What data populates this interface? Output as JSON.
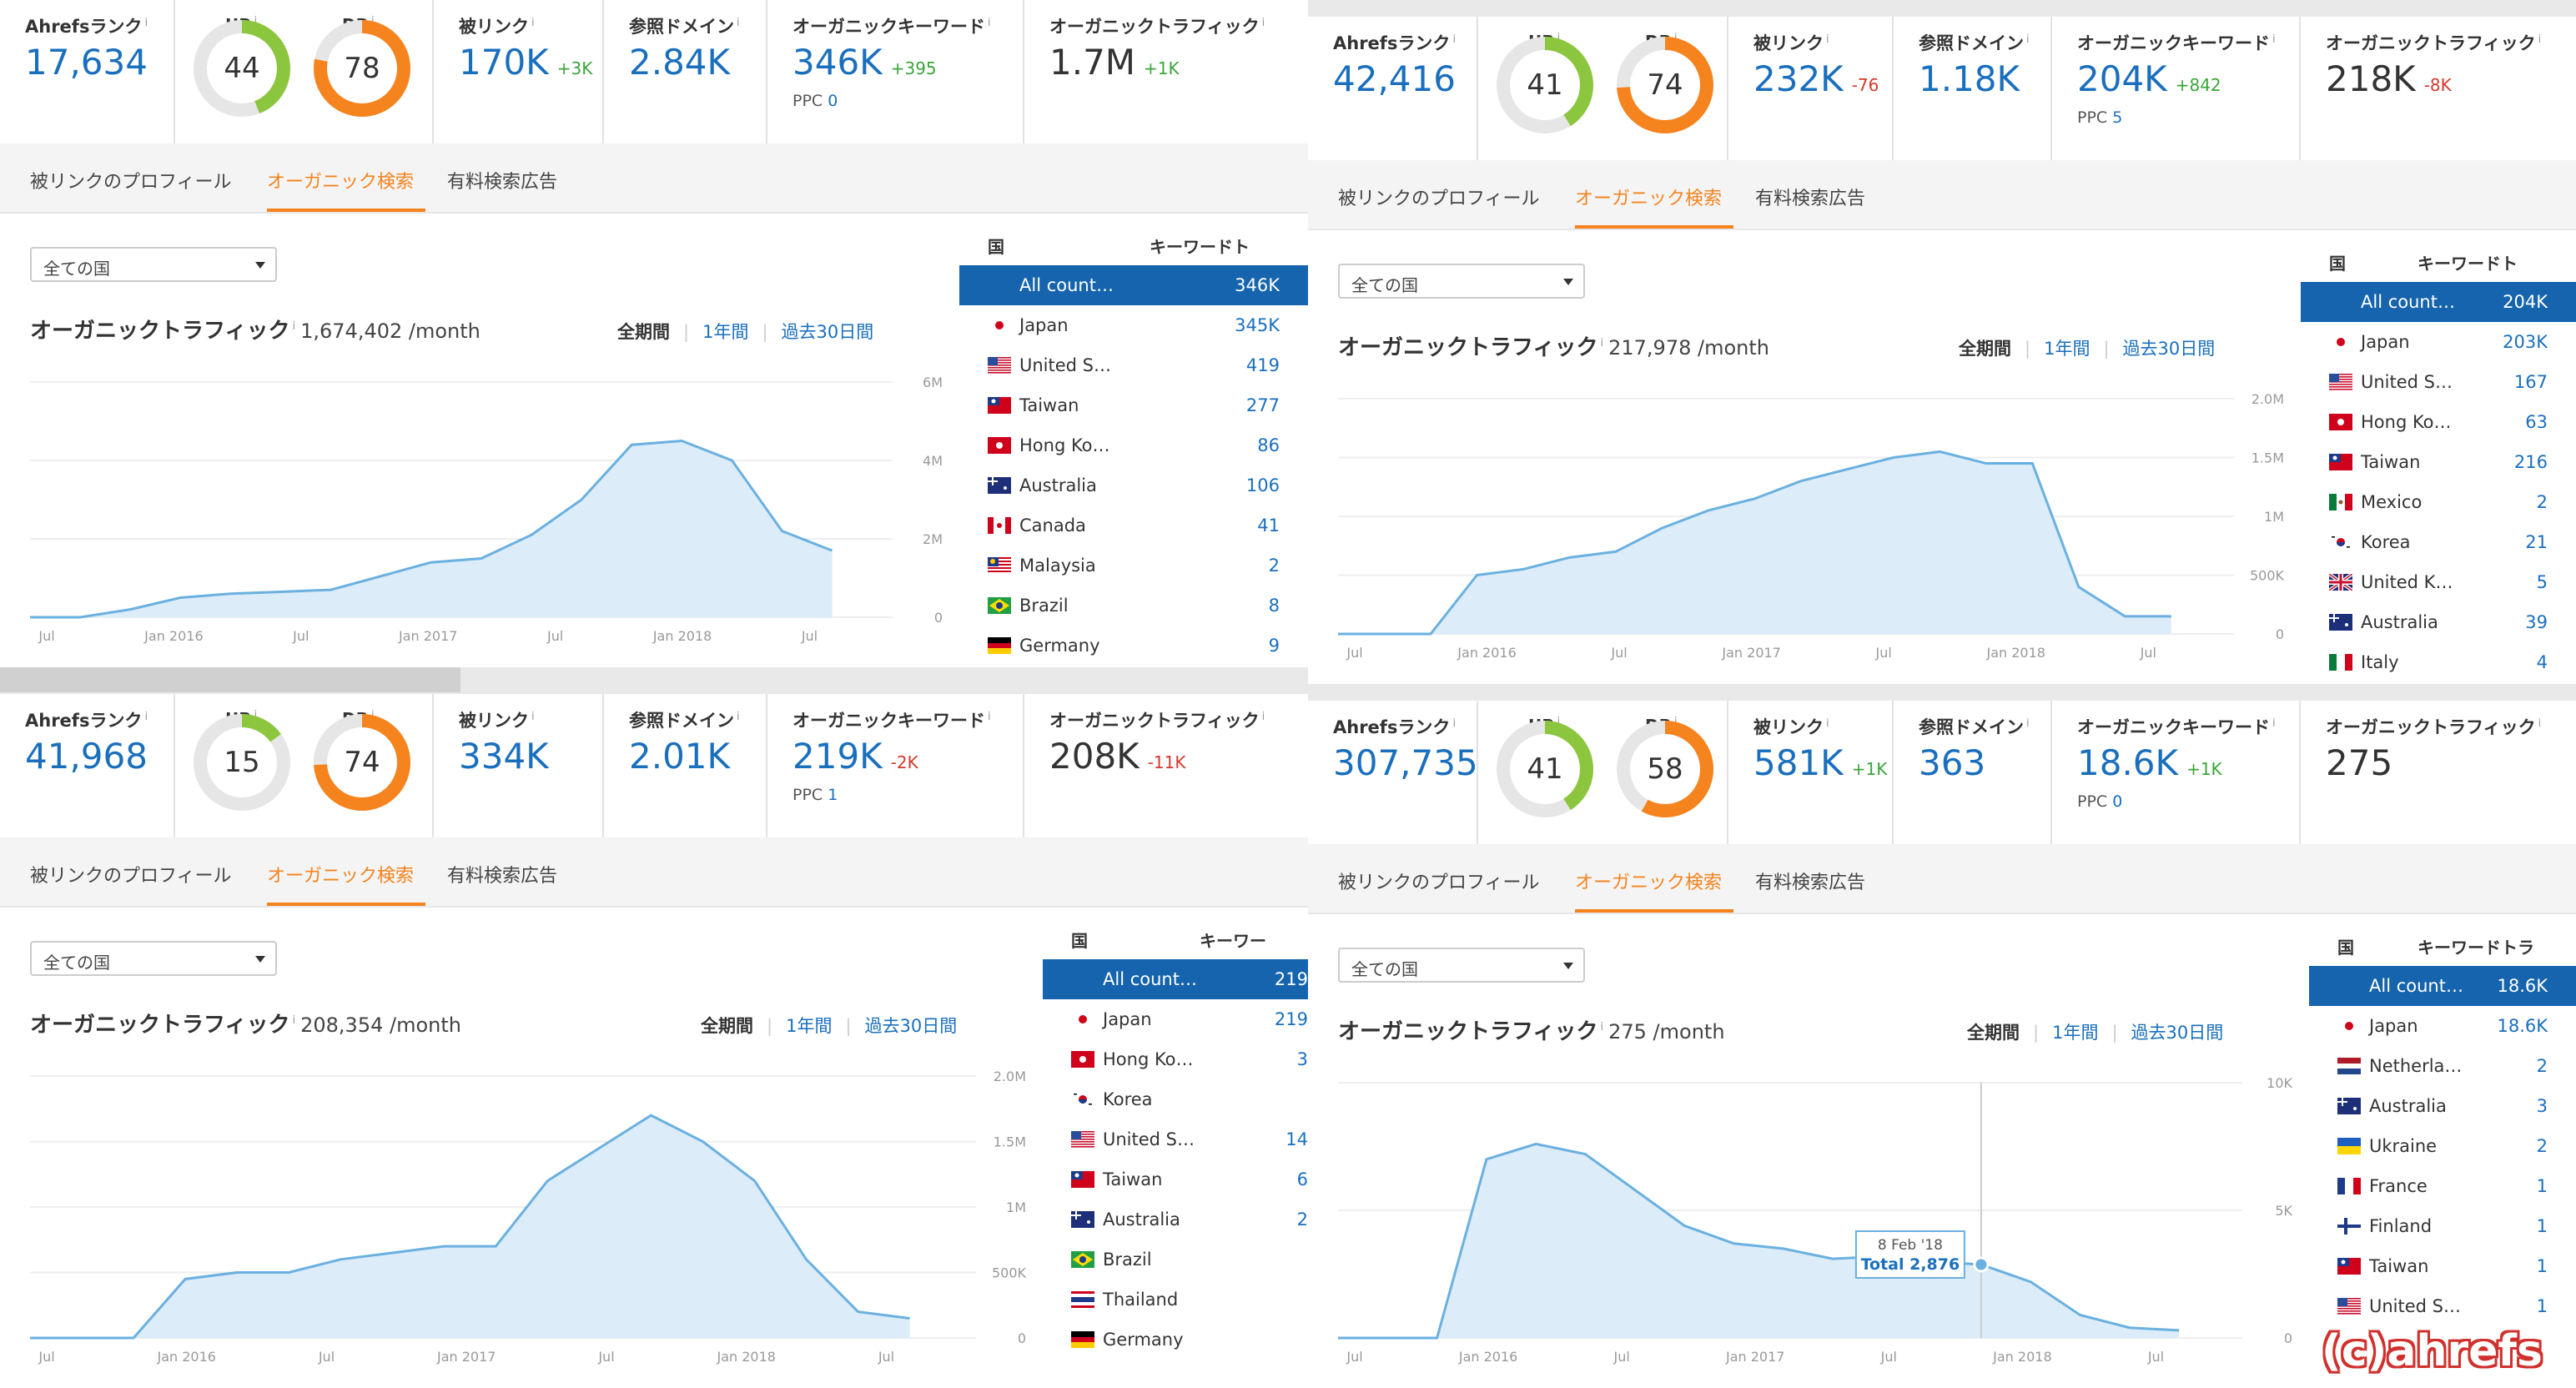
{
  "labels": {
    "rank": "Ahrefsランク",
    "ur": "UR",
    "dr": "DR",
    "backlinks": "被リンク",
    "refdomains": "参照ドメイン",
    "keywords": "オーガニックキーワード",
    "traffic": "オーガニックトラフィック",
    "ppc": "PPC",
    "info": "i",
    "tab_backlinks": "被リンクのプロフィール",
    "tab_organic": "オーガニック検索",
    "tab_paid": "有料検索広告",
    "country_select": "全ての国",
    "chart_title": "オーガニックトラフィック",
    "range_all": "全期間",
    "range_1y": "1年間",
    "range_30d": "過去30日間",
    "col_country": "国",
    "col_keywords": "キーワードト",
    "col_keywords_short": "キーワー",
    "col_keywords_4": "キーワードトラ"
  },
  "colors": {
    "accent": "#f5841f",
    "link": "#1a6fbd",
    "selected_row": "#1564ad",
    "ur_ring": "#8cc63f",
    "dr_ring": "#f5841f",
    "chart_line": "#6ab0e0",
    "chart_fill": "#dcecf8"
  },
  "panels": [
    {
      "rank": "17,634",
      "ur": "44",
      "ur_pct": 44,
      "dr": "78",
      "dr_pct": 78,
      "backlinks": "170K",
      "backlinks_delta": "+3K",
      "refdomains": "2.84K",
      "keywords": "346K",
      "keywords_delta": "+395",
      "ppc": "0",
      "traffic": "1.7M",
      "traffic_delta": "+1K",
      "monthly": "1,674,402 /month",
      "countries": [
        {
          "name": "All count…",
          "value": "346K",
          "flag": "none"
        },
        {
          "name": "Japan",
          "value": "345K",
          "flag": "jp"
        },
        {
          "name": "United S…",
          "value": "419",
          "flag": "us"
        },
        {
          "name": "Taiwan",
          "value": "277",
          "flag": "tw"
        },
        {
          "name": "Hong Ko…",
          "value": "86",
          "flag": "hk"
        },
        {
          "name": "Australia",
          "value": "106",
          "flag": "au"
        },
        {
          "name": "Canada",
          "value": "41",
          "flag": "ca"
        },
        {
          "name": "Malaysia",
          "value": "2",
          "flag": "my"
        },
        {
          "name": "Brazil",
          "value": "8",
          "flag": "br"
        },
        {
          "name": "Germany",
          "value": "9",
          "flag": "de"
        }
      ],
      "chart_data": {
        "type": "area",
        "x": [
          "2015-07",
          "2015-10",
          "2016-01",
          "2016-04",
          "2016-07",
          "2016-10",
          "2017-01",
          "2017-04",
          "2017-07",
          "2017-10",
          "2018-01",
          "2018-03",
          "2018-05",
          "2018-06",
          "2018-07",
          "2018-08",
          "2018-09"
        ],
        "y": [
          0,
          0,
          200000,
          500000,
          600000,
          650000,
          700000,
          1050000,
          1400000,
          1500000,
          2100000,
          3000000,
          4400000,
          4500000,
          4000000,
          2200000,
          1700000
        ],
        "yticks": [
          "6M",
          "4M",
          "2M",
          "0"
        ],
        "ylim": [
          0,
          6000000
        ],
        "xticks": [
          "Jul",
          "Jan 2016",
          "Jul",
          "Jan 2017",
          "Jul",
          "Jan 2018",
          "Jul"
        ]
      }
    },
    {
      "rank": "42,416",
      "ur": "41",
      "ur_pct": 41,
      "dr": "74",
      "dr_pct": 74,
      "backlinks": "232K",
      "backlinks_delta": "-76",
      "refdomains": "1.18K",
      "keywords": "204K",
      "keywords_delta": "+842",
      "ppc": "5",
      "traffic": "218K",
      "traffic_delta": "-8K",
      "monthly": "217,978 /month",
      "countries": [
        {
          "name": "All count…",
          "value": "204K",
          "flag": "none"
        },
        {
          "name": "Japan",
          "value": "203K",
          "flag": "jp"
        },
        {
          "name": "United S…",
          "value": "167",
          "flag": "us"
        },
        {
          "name": "Hong Ko…",
          "value": "63",
          "flag": "hk"
        },
        {
          "name": "Taiwan",
          "value": "216",
          "flag": "tw"
        },
        {
          "name": "Mexico",
          "value": "2",
          "flag": "mx"
        },
        {
          "name": "Korea",
          "value": "21",
          "flag": "kr"
        },
        {
          "name": "United K…",
          "value": "5",
          "flag": "gb"
        },
        {
          "name": "Australia",
          "value": "39",
          "flag": "au"
        },
        {
          "name": "Italy",
          "value": "4",
          "flag": "it"
        }
      ],
      "chart_data": {
        "type": "area",
        "x": [
          "2015-07",
          "2015-10",
          "2016-01",
          "2016-01b",
          "2016-04",
          "2016-07",
          "2016-10",
          "2017-01",
          "2017-04",
          "2017-07",
          "2017-10",
          "2018-01",
          "2018-03",
          "2018-04",
          "2018-05",
          "2018-06",
          "2018-07",
          "2018-08",
          "2018-09"
        ],
        "y": [
          0,
          0,
          0,
          500000,
          550000,
          650000,
          700000,
          900000,
          1050000,
          1150000,
          1300000,
          1400000,
          1500000,
          1550000,
          1450000,
          1450000,
          400000,
          150000,
          150000
        ],
        "yticks": [
          "2.0M",
          "1.5M",
          "1M",
          "500K",
          "0"
        ],
        "ylim": [
          0,
          2000000
        ],
        "xticks": [
          "Jul",
          "Jan 2016",
          "Jul",
          "Jan 2017",
          "Jul",
          "Jan 2018",
          "Jul"
        ]
      }
    },
    {
      "rank": "41,968",
      "ur": "15",
      "ur_pct": 15,
      "dr": "74",
      "dr_pct": 74,
      "backlinks": "334K",
      "backlinks_delta": "",
      "refdomains": "2.01K",
      "keywords": "219K",
      "keywords_delta": "-2K",
      "ppc": "1",
      "traffic": "208K",
      "traffic_delta": "-11K",
      "monthly": "208,354 /month",
      "countries": [
        {
          "name": "All count…",
          "value": "219",
          "flag": "none"
        },
        {
          "name": "Japan",
          "value": "219",
          "flag": "jp"
        },
        {
          "name": "Hong Ko…",
          "value": "3",
          "flag": "hk"
        },
        {
          "name": "Korea",
          "value": "",
          "flag": "kr"
        },
        {
          "name": "United S…",
          "value": "14",
          "flag": "us"
        },
        {
          "name": "Taiwan",
          "value": "6",
          "flag": "tw"
        },
        {
          "name": "Australia",
          "value": "2",
          "flag": "au"
        },
        {
          "name": "Brazil",
          "value": "",
          "flag": "br"
        },
        {
          "name": "Thailand",
          "value": "",
          "flag": "th"
        },
        {
          "name": "Germany",
          "value": "",
          "flag": "de"
        }
      ],
      "chart_data": {
        "type": "area",
        "x": [
          "2015-07",
          "2015-10",
          "2016-01",
          "2016-01b",
          "2016-04",
          "2016-07",
          "2016-10",
          "2017-01",
          "2017-04",
          "2017-07",
          "2017-10",
          "2018-01",
          "2018-03",
          "2018-05",
          "2018-06",
          "2018-07",
          "2018-08",
          "2018-09"
        ],
        "y": [
          0,
          0,
          0,
          450000,
          500000,
          500000,
          600000,
          650000,
          700000,
          700000,
          1200000,
          1450000,
          1700000,
          1500000,
          1200000,
          600000,
          200000,
          150000
        ],
        "yticks": [
          "2.0M",
          "1.5M",
          "1M",
          "500K",
          "0"
        ],
        "ylim": [
          0,
          2000000
        ],
        "xticks": [
          "Jul",
          "Jan 2016",
          "Jul",
          "Jan 2017",
          "Jul",
          "Jan 2018",
          "Jul"
        ]
      }
    },
    {
      "rank": "307,735",
      "ur": "41",
      "ur_pct": 41,
      "dr": "58",
      "dr_pct": 58,
      "backlinks": "581K",
      "backlinks_delta": "+1K",
      "refdomains": "363",
      "keywords": "18.6K",
      "keywords_delta": "+1K",
      "ppc": "0",
      "traffic": "275",
      "traffic_delta": "",
      "monthly": "275 /month",
      "tooltip_date": "8 Feb '18",
      "tooltip_total": "Total 2,876",
      "countries": [
        {
          "name": "All count…",
          "value": "18.6K",
          "flag": "none"
        },
        {
          "name": "Japan",
          "value": "18.6K",
          "flag": "jp"
        },
        {
          "name": "Netherla…",
          "value": "2",
          "flag": "nl"
        },
        {
          "name": "Australia",
          "value": "3",
          "flag": "au"
        },
        {
          "name": "Ukraine",
          "value": "2",
          "flag": "ua"
        },
        {
          "name": "France",
          "value": "1",
          "flag": "fr"
        },
        {
          "name": "Finland",
          "value": "1",
          "flag": "fi"
        },
        {
          "name": "Taiwan",
          "value": "1",
          "flag": "tw"
        },
        {
          "name": "United S…",
          "value": "1",
          "flag": "us"
        }
      ],
      "chart_data": {
        "type": "area",
        "x": [
          "2015-07",
          "2015-10",
          "2016-01",
          "2016-01b",
          "2016-03",
          "2016-05",
          "2016-07",
          "2016-10",
          "2017-01",
          "2017-04",
          "2017-07",
          "2017-10",
          "2018-01",
          "2018-02",
          "2018-04",
          "2018-06",
          "2018-08",
          "2018-09"
        ],
        "y": [
          0,
          0,
          0,
          7000,
          7600,
          7200,
          5800,
          4400,
          3700,
          3500,
          3100,
          3200,
          3000,
          2876,
          2200,
          900,
          400,
          300
        ],
        "yticks": [
          "10K",
          "5K",
          "0"
        ],
        "ylim": [
          0,
          10000
        ],
        "xticks": [
          "Jul",
          "Jan 2016",
          "Jul",
          "Jan 2017",
          "Jul",
          "Jan 2018",
          "Jul"
        ]
      }
    }
  ],
  "watermark": "(c)ahrefs"
}
